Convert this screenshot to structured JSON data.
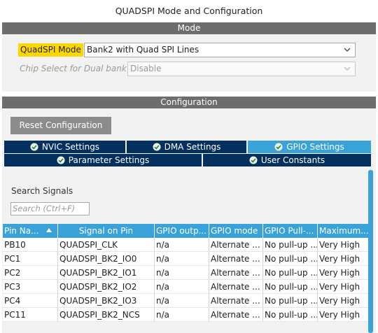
{
  "window": {
    "title": "QUADSPI Mode and Configuration"
  },
  "mode_section": {
    "header": "Mode",
    "quadspi_mode": {
      "label": "QuadSPI Mode",
      "value": "Bank2 with Quad SPI Lines"
    },
    "chip_select": {
      "label": "Chip Select for Dual bank",
      "value": "Disable"
    }
  },
  "config_section": {
    "header": "Configuration",
    "reset_button": "Reset Configuration",
    "tabs_row1": [
      {
        "label": "NVIC Settings",
        "active": false
      },
      {
        "label": "DMA Settings",
        "active": false
      },
      {
        "label": "GPIO Settings",
        "active": true
      }
    ],
    "tabs_row2": [
      {
        "label": "Parameter Settings",
        "active": false
      },
      {
        "label": "User Constants",
        "active": false
      }
    ],
    "search": {
      "label": "Search Signals",
      "placeholder": "Search (Ctrl+F)"
    },
    "table": {
      "columns": [
        "Pin Na...",
        "Signal on Pin",
        "GPIO outp...",
        "GPIO mode",
        "GPIO Pull-...",
        "Maximum..."
      ],
      "rows": [
        [
          "PB10",
          "QUADSPI_CLK",
          "n/a",
          "Alternate ...",
          "No pull-up ...",
          "Very High"
        ],
        [
          "PC1",
          "QUADSPI_BK2_IO0",
          "n/a",
          "Alternate ...",
          "No pull-up ...",
          "Very High"
        ],
        [
          "PC2",
          "QUADSPI_BK2_IO1",
          "n/a",
          "Alternate ...",
          "No pull-up ...",
          "Very High"
        ],
        [
          "PC3",
          "QUADSPI_BK2_IO2",
          "n/a",
          "Alternate ...",
          "No pull-up ...",
          "Very High"
        ],
        [
          "PC4",
          "QUADSPI_BK2_IO3",
          "n/a",
          "Alternate ...",
          "No pull-up ...",
          "Very High"
        ],
        [
          "PC11",
          "QUADSPI_BK2_NCS",
          "n/a",
          "Alternate ...",
          "No pull-up ...",
          "Very High"
        ]
      ]
    }
  },
  "colors": {
    "section_header": "#6d6d6d",
    "tab_inactive": "#04305f",
    "tab_active": "#38a2d9",
    "table_header": "#38a2d9",
    "highlight": "#ffd700"
  }
}
